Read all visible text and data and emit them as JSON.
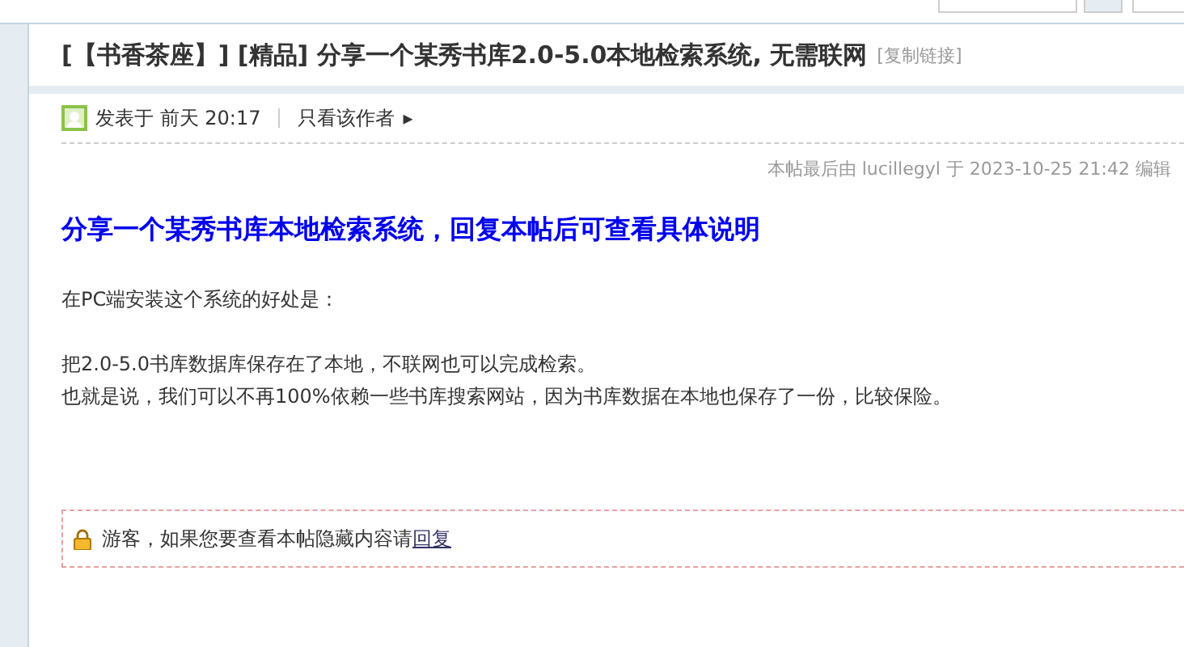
{
  "thread": {
    "title": "[【书香茶座】] [精品] 分享一个某秀书库2.0-5.0本地检索系统, 无需联网",
    "copy_link": "[复制链接]"
  },
  "post_meta": {
    "posted": "发表于 前天 20:17",
    "author_only": "只看该作者",
    "arrow": "▸"
  },
  "post": {
    "edit_note": "本帖最后由 lucillegyl 于 2023-10-25 21:42 编辑",
    "heading": "分享一个某秀书库本地检索系统，回复本帖后可查看具体说明",
    "blocks": [
      [
        "在PC端安装这个系统的好处是："
      ],
      [
        "把2.0-5.0书库数据库保存在了本地，不联网也可以完成检索。",
        "也就是说，我们可以不再100%依赖一些书库搜索网站，因为书库数据在本地也保存了一份，比较保险。"
      ]
    ]
  },
  "hidden_notice": {
    "text": "游客，如果您要查看本帖隐藏内容请",
    "link": "回复"
  }
}
